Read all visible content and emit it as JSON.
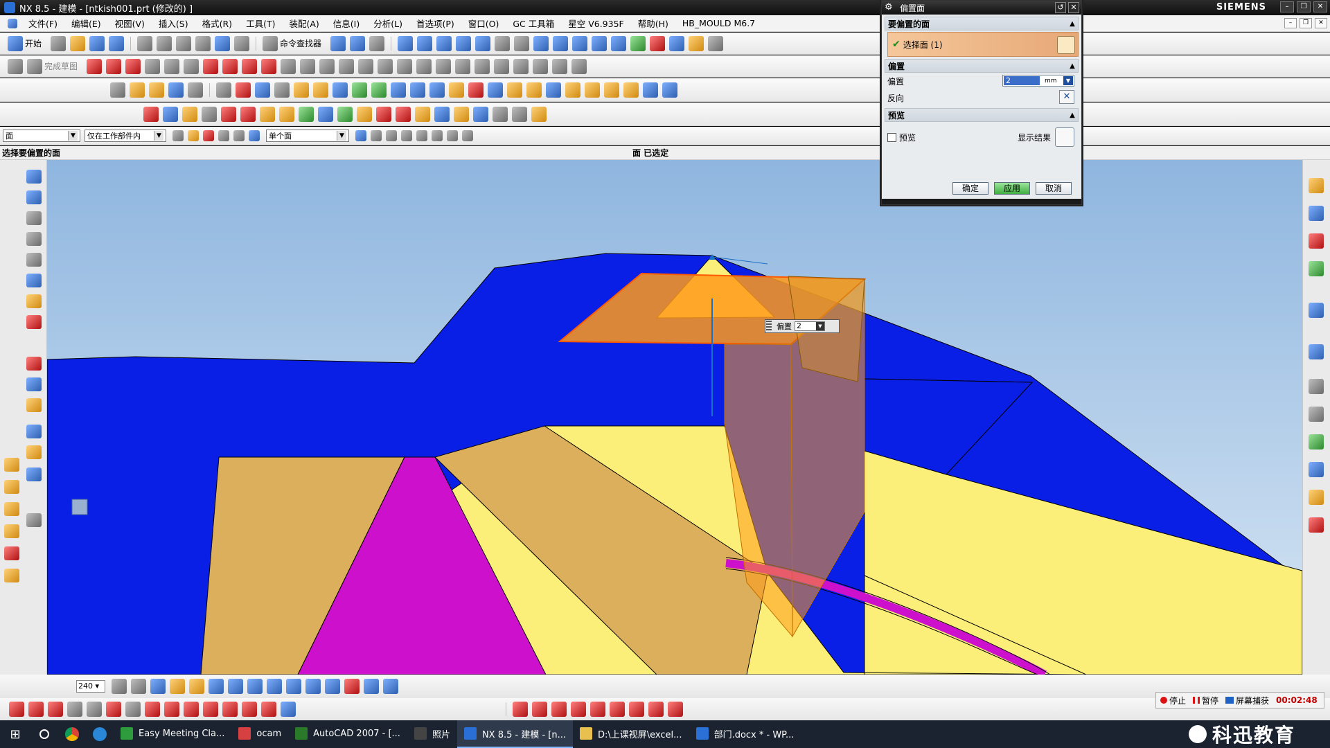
{
  "window": {
    "title": "NX 8.5 - 建模 - [ntkish001.prt  (修改的) ]",
    "brand": "SIEMENS"
  },
  "menubar": {
    "items": [
      "文件(F)",
      "编辑(E)",
      "视图(V)",
      "插入(S)",
      "格式(R)",
      "工具(T)",
      "装配(A)",
      "信息(I)",
      "分析(L)",
      "首选项(P)",
      "窗口(O)",
      "GC 工具箱",
      "星空 V6.935F",
      "帮助(H)",
      "HB_MOULD M6.7"
    ]
  },
  "toolbar": {
    "start_label": "开始",
    "command_finder_label": "命令查找器",
    "sketch_label": "完成草图"
  },
  "selection_bar": {
    "type_filter": "面",
    "scope": "仅在工作部件内",
    "face_rule": "单个面"
  },
  "cue_line": {
    "prompt": "选择要偏置的面",
    "status": "面 已选定"
  },
  "dialog": {
    "title": "偏置面",
    "group_faces": "要偏置的面",
    "select_face_label": "选择面 (1)",
    "group_offset": "偏置",
    "offset_label": "偏置",
    "offset_value": "2",
    "offset_unit": "mm",
    "reverse_label": "反向",
    "group_preview": "预览",
    "preview_checkbox_label": "预览",
    "preview_checked": false,
    "show_result_label": "显示结果",
    "ok_label": "确定",
    "apply_label": "应用",
    "cancel_label": "取消"
  },
  "viewport": {
    "dynamic_input_label": "偏置",
    "dynamic_input_value": "2",
    "colors": {
      "background_top": "#8fb6df",
      "background_bottom": "#d8e6f4",
      "blue_face": "#0a1fe6",
      "yellow_face": "#fbef7a",
      "tan_face": "#dcaf5c",
      "magenta_face": "#cc10cc",
      "selected_face": "#ff9a1a"
    }
  },
  "bottom_toolbar": {
    "zoom_value": "240"
  },
  "recorder": {
    "stop_label": "停止",
    "pause_label": "暂停",
    "capture_label": "屏幕捕获",
    "time": "00:02:48"
  },
  "taskbar": {
    "items": [
      {
        "label": "Easy Meeting Cla...",
        "icon_color": "#2e9b3c"
      },
      {
        "label": "ocam",
        "icon_color": "#d64040"
      },
      {
        "label": "AutoCAD 2007 - [...",
        "icon_color": "#2a7a2a"
      },
      {
        "label": "照片",
        "icon_color": "#444444"
      },
      {
        "label": "NX 8.5 - 建模 - [n...",
        "icon_color": "#2a6fd6",
        "active": true
      },
      {
        "label": "D:\\上课视屏\\excel...",
        "icon_color": "#e8c050"
      },
      {
        "label": "部门.docx * - WP...",
        "icon_color": "#2a70d6"
      }
    ],
    "watermark": "科迅教育"
  }
}
